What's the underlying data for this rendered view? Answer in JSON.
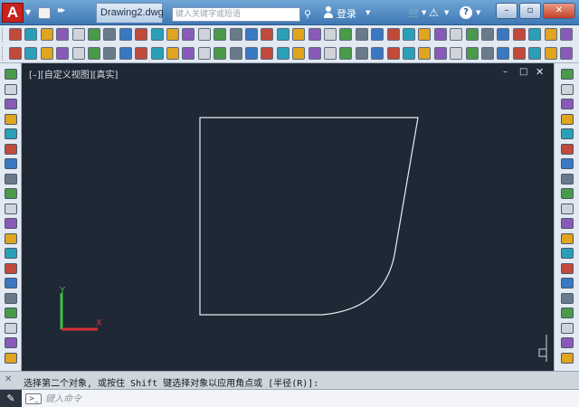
{
  "window": {
    "app_logo": "A",
    "document_tab": "Drawing2.dwg",
    "search_placeholder": "键入关键字或短语",
    "login_label": "登录",
    "help_label": "?",
    "minimize_label": "–",
    "maximize_label": "▫",
    "close_label": "✕"
  },
  "viewport": {
    "label": "[–][自定义视图][真实]",
    "min_label": "–",
    "restore_label": "□",
    "close_label": "✕"
  },
  "ucs": {
    "x_axis_label": "X",
    "y_axis_label": "Y"
  },
  "command": {
    "history_text": "选择第二个对象, 或按住 Shift 键选择对象以应用角点或 [半径(R)]:",
    "history_close": "✕",
    "prompt_icon": ">_",
    "input_placeholder": "键入命令"
  },
  "colors": {
    "canvas_background": "#1f2835",
    "drawing_line": "#e8ecef",
    "x_axis": "#d2323c",
    "y_axis": "#3cbf4a",
    "app_red": "#c8231e"
  },
  "icons": {
    "app": "autocad-logo",
    "search": "binoculars-icon",
    "user": "user-icon",
    "cart": "cart-icon",
    "exchange": "exchange-icon",
    "help": "help-icon",
    "command": "wrench-icon"
  }
}
